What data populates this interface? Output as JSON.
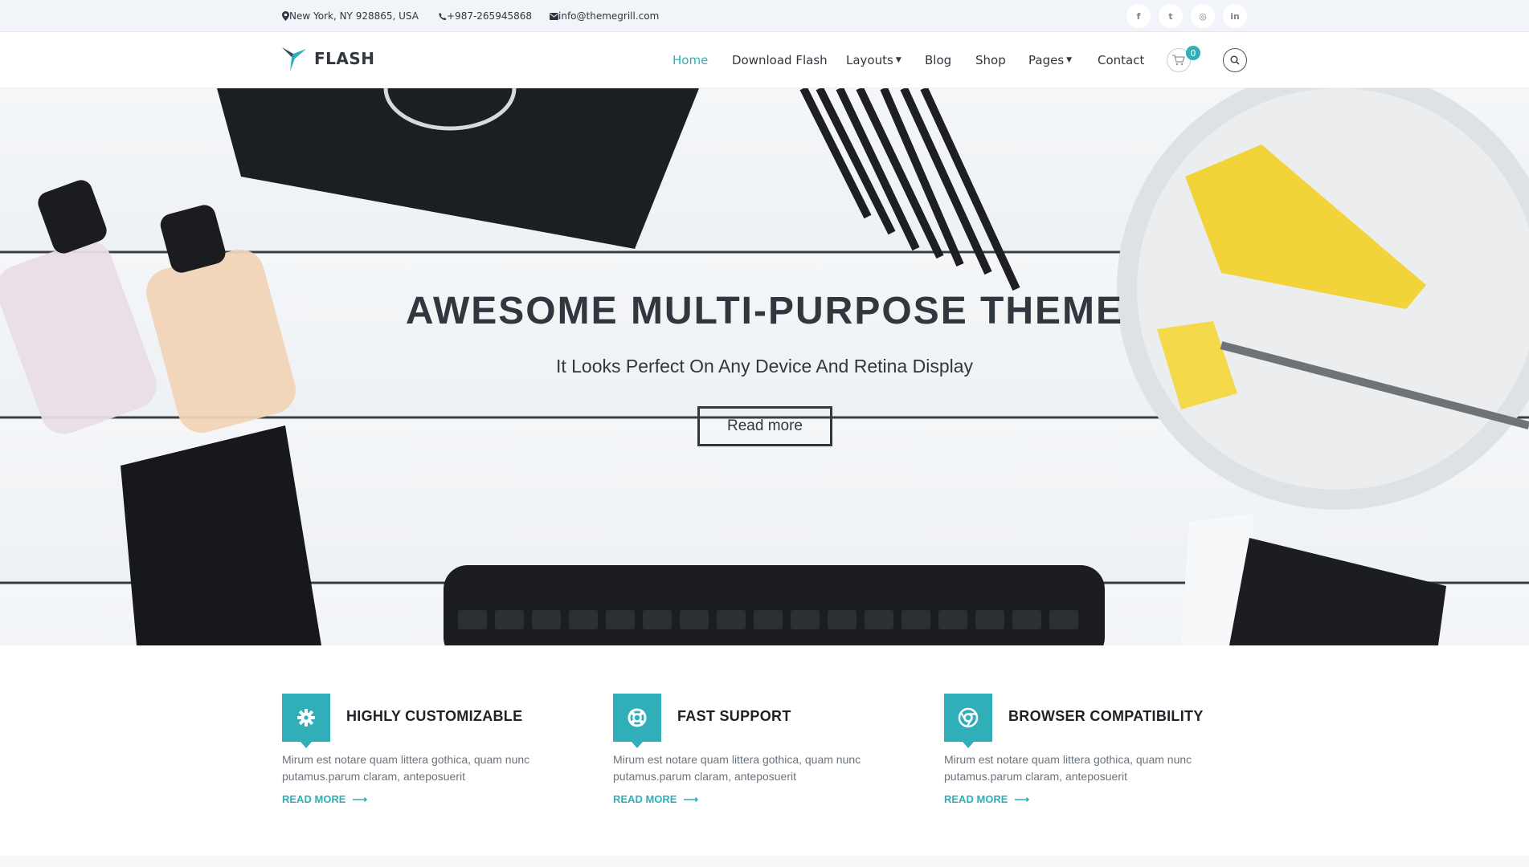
{
  "topbar": {
    "address": "New York, NY 928865, USA",
    "phone": "+987-265945868",
    "email": "info@themegrill.com",
    "social": [
      {
        "icon": "facebook-icon",
        "glyph": "f"
      },
      {
        "icon": "twitter-icon",
        "glyph": "t"
      },
      {
        "icon": "instagram-icon",
        "glyph": "◎"
      },
      {
        "icon": "linkedin-icon",
        "glyph": "in"
      }
    ]
  },
  "header": {
    "logo_text": "FLASH",
    "nav": [
      {
        "label": "Home",
        "active": true
      },
      {
        "label": "Download Flash"
      },
      {
        "label": "Layouts",
        "dropdown": true
      },
      {
        "label": "Blog"
      },
      {
        "label": "Shop"
      },
      {
        "label": "Pages",
        "dropdown": true
      },
      {
        "label": "Contact"
      }
    ],
    "cart_count": "0"
  },
  "hero": {
    "title": "AWESOME MULTI-PURPOSE THEME",
    "subtitle": "It Looks Perfect On Any Device And Retina Display",
    "button": "Read more"
  },
  "features": [
    {
      "icon": "gear-icon",
      "title": "HIGHLY CUSTOMIZABLE",
      "text": "Mirum est notare quam littera gothica, quam nunc putamus.parum claram, anteposuerit",
      "more": "READ MORE"
    },
    {
      "icon": "lifebuoy-icon",
      "title": "FAST SUPPORT",
      "text": "Mirum est notare quam littera gothica, quam nunc putamus.parum claram, anteposuerit",
      "more": "READ MORE"
    },
    {
      "icon": "chrome-icon",
      "title": "BROWSER COMPATIBILITY",
      "text": "Mirum est notare quam littera gothica, quam nunc putamus.parum claram, anteposuerit",
      "more": "READ MORE"
    }
  ],
  "colors": {
    "accent": "#30afb8",
    "text": "#30373e",
    "topbar_bg": "#f1f4f8"
  }
}
